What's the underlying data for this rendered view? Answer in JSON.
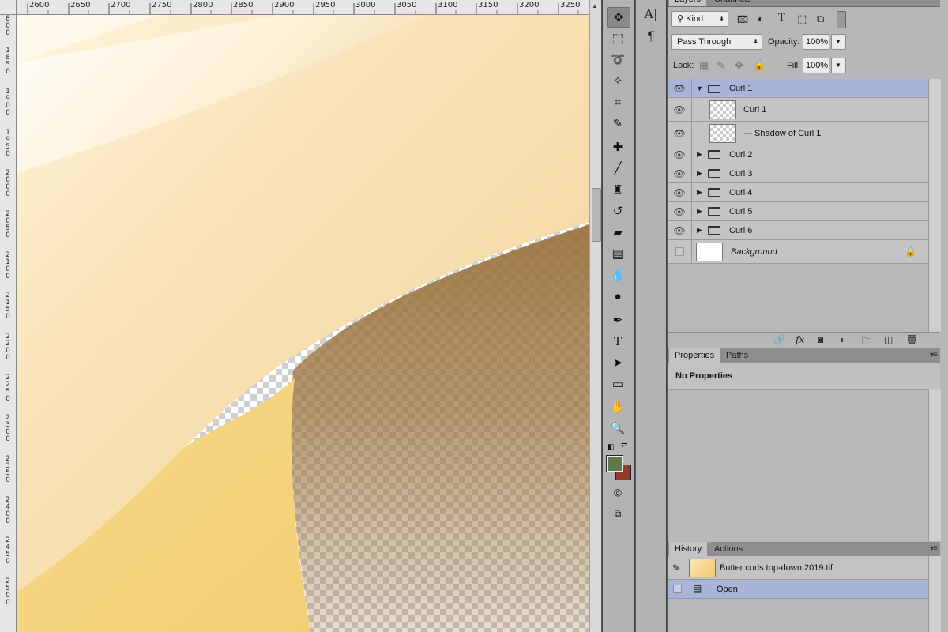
{
  "ruler_top": {
    "labels": [
      "2600",
      "2650",
      "2700",
      "2750",
      "2800",
      "2850",
      "2900",
      "2950",
      "3000",
      "3050",
      "3100",
      "3150",
      "3200",
      "3250"
    ]
  },
  "ruler_left": {
    "labels": [
      "800",
      "1850",
      "1900",
      "1950",
      "2000",
      "2050",
      "2100",
      "2150",
      "2200",
      "2250",
      "2300",
      "2350",
      "2400",
      "2450",
      "2500"
    ]
  },
  "toolbar": {
    "tools": [
      "move-tool",
      "marquee-tool",
      "lasso-tool",
      "magic-wand-tool",
      "crop-tool",
      "eyedropper-tool",
      "healing-brush-tool",
      "brush-tool",
      "clone-stamp-tool",
      "history-brush-tool",
      "eraser-tool",
      "gradient-tool",
      "blur-tool",
      "dodge-tool",
      "pen-tool",
      "type-tool",
      "path-selection-tool",
      "shape-tool",
      "hand-tool",
      "zoom-tool"
    ],
    "foreground_color": "#5e7a4c",
    "background_color": "#8f3a2a"
  },
  "strip": {
    "character_label": "A|",
    "paragraph_label": "¶"
  },
  "layers_panel": {
    "tabs": [
      "Layers",
      "Channels"
    ],
    "kind_label": "Kind",
    "blend_mode": "Pass Through",
    "opacity_label": "Opacity:",
    "opacity_value": "100%",
    "lock_label": "Lock:",
    "fill_label": "Fill:",
    "fill_value": "100%",
    "layers": [
      {
        "name": "Curl 1",
        "type": "group-open",
        "visible": true,
        "selected": true
      },
      {
        "name": "Curl 1",
        "type": "layer",
        "visible": true,
        "selected": false
      },
      {
        "name": "--- Shadow of Curl 1",
        "type": "layer",
        "visible": true,
        "selected": false
      },
      {
        "name": "Curl 2",
        "type": "group",
        "visible": true,
        "selected": false
      },
      {
        "name": "Curl 3",
        "type": "group",
        "visible": true,
        "selected": false
      },
      {
        "name": "Curl 4",
        "type": "group",
        "visible": true,
        "selected": false
      },
      {
        "name": "Curl 5",
        "type": "group",
        "visible": true,
        "selected": false
      },
      {
        "name": "Curl 6",
        "type": "group",
        "visible": true,
        "selected": false
      },
      {
        "name": "Background",
        "type": "background",
        "visible": false,
        "selected": false
      }
    ]
  },
  "properties_panel": {
    "tabs": [
      "Properties",
      "Paths"
    ],
    "message": "No Properties"
  },
  "history_panel": {
    "tabs": [
      "History",
      "Actions"
    ],
    "snapshot_name": "Butter curls top-down 2019.tif",
    "steps": [
      "Open"
    ]
  }
}
